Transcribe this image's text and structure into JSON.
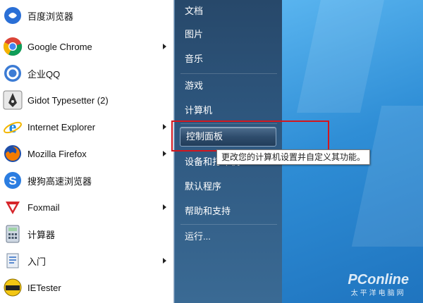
{
  "programs": [
    {
      "label": "百度浏览器",
      "icon": "baidu-browser-icon",
      "has_submenu": false
    },
    {
      "label": "Google Chrome",
      "icon": "chrome-icon",
      "has_submenu": true
    },
    {
      "label": "企业QQ",
      "icon": "qq-enterprise-icon",
      "has_submenu": false
    },
    {
      "label": "Gidot Typesetter (2)",
      "icon": "gidot-typesetter-icon",
      "has_submenu": false
    },
    {
      "label": "Internet Explorer",
      "icon": "internet-explorer-icon",
      "has_submenu": true
    },
    {
      "label": "Mozilla Firefox",
      "icon": "firefox-icon",
      "has_submenu": true
    },
    {
      "label": "搜狗高速浏览器",
      "icon": "sogou-browser-icon",
      "has_submenu": false
    },
    {
      "label": "Foxmail",
      "icon": "foxmail-icon",
      "has_submenu": true
    },
    {
      "label": "计算器",
      "icon": "calculator-icon",
      "has_submenu": false
    },
    {
      "label": "入门",
      "icon": "getting-started-icon",
      "has_submenu": true
    },
    {
      "label": "IETester",
      "icon": "ietester-icon",
      "has_submenu": false
    }
  ],
  "places": [
    {
      "label": "文档"
    },
    {
      "label": "图片"
    },
    {
      "label": "音乐"
    },
    {
      "label": "游戏"
    },
    {
      "label": "计算机"
    },
    {
      "label": "控制面板",
      "highlighted": true
    },
    {
      "label": "设备和打印机"
    },
    {
      "label": "默认程序"
    },
    {
      "label": "帮助和支持"
    },
    {
      "label": "运行..."
    }
  ],
  "tooltip": {
    "text": "更改您的计算机设置并自定义其功能。"
  },
  "watermark": {
    "brand": "PConline",
    "sub": "太平洋电脑网"
  },
  "colors": {
    "annotation_red": "#d2161e",
    "desktop_blue": "#2f8ed6",
    "menu_dark": "#2d557c"
  }
}
